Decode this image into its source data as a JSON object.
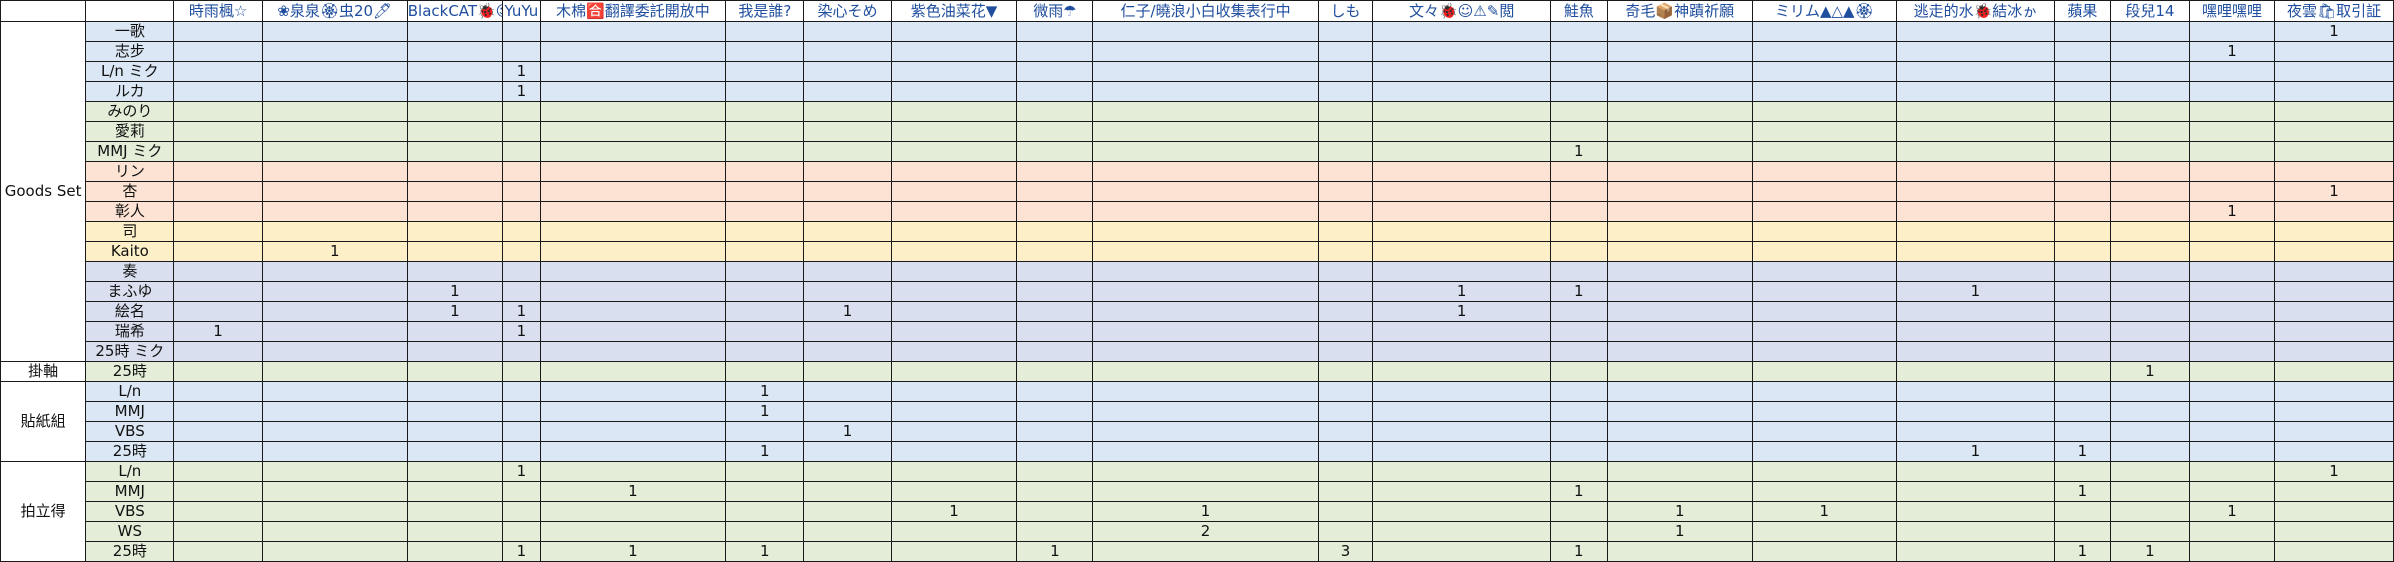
{
  "row_colors": {
    "blue": "#dbe7f4",
    "green": "#e3edd8",
    "orange": "#fce3d4",
    "yellow": "#fdefc8",
    "lavender": "#dadfef"
  },
  "header_color": "#1f4e9e",
  "columns": [
    "時雨楓☆",
    "❀泉泉🏵虫20🖊",
    "BlackCAT🐞☺",
    "YuYu",
    "木棉🈴翻譯委託開放中",
    "我是誰?",
    "染心そめ",
    "紫色油菜花▼",
    "微雨☂",
    "仁子/曉浪小白收集表行中",
    "しも",
    "文々🐞☺⚠✎閲",
    "鮭魚",
    "奇毛📦神蹟祈願",
    "ミリム▲△▲🏵",
    "逃走的水🐞結冰ゕ",
    "蘋果",
    "段兒14",
    "嘿哩嘿哩",
    "夜雲🛍取引証"
  ],
  "groups": [
    {
      "label": "Goods Set",
      "rows": [
        {
          "label": "一歌",
          "color": "blue",
          "cells": [
            "",
            "",
            "",
            "",
            "",
            "",
            "",
            "",
            "",
            "",
            "",
            "",
            "",
            "",
            "",
            "",
            "",
            "",
            "",
            "1"
          ]
        },
        {
          "label": "志步",
          "color": "blue",
          "cells": [
            "",
            "",
            "",
            "",
            "",
            "",
            "",
            "",
            "",
            "",
            "",
            "",
            "",
            "",
            "",
            "",
            "",
            "",
            "1",
            ""
          ]
        },
        {
          "label": "L/n ミク",
          "color": "blue",
          "cells": [
            "",
            "",
            "",
            "1",
            "",
            "",
            "",
            "",
            "",
            "",
            "",
            "",
            "",
            "",
            "",
            "",
            "",
            "",
            "",
            ""
          ]
        },
        {
          "label": "ルカ",
          "color": "blue",
          "cells": [
            "",
            "",
            "",
            "1",
            "",
            "",
            "",
            "",
            "",
            "",
            "",
            "",
            "",
            "",
            "",
            "",
            "",
            "",
            "",
            ""
          ]
        },
        {
          "label": "みのり",
          "color": "green",
          "cells": [
            "",
            "",
            "",
            "",
            "",
            "",
            "",
            "",
            "",
            "",
            "",
            "",
            "",
            "",
            "",
            "",
            "",
            "",
            "",
            ""
          ]
        },
        {
          "label": "愛莉",
          "color": "green",
          "cells": [
            "",
            "",
            "",
            "",
            "",
            "",
            "",
            "",
            "",
            "",
            "",
            "",
            "",
            "",
            "",
            "",
            "",
            "",
            "",
            ""
          ]
        },
        {
          "label": "MMJ ミク",
          "color": "green",
          "cells": [
            "",
            "",
            "",
            "",
            "",
            "",
            "",
            "",
            "",
            "",
            "",
            "",
            "1",
            "",
            "",
            "",
            "",
            "",
            "",
            ""
          ]
        },
        {
          "label": "リン",
          "color": "orange",
          "cells": [
            "",
            "",
            "",
            "",
            "",
            "",
            "",
            "",
            "",
            "",
            "",
            "",
            "",
            "",
            "",
            "",
            "",
            "",
            "",
            ""
          ]
        },
        {
          "label": "杏",
          "color": "orange",
          "cells": [
            "",
            "",
            "",
            "",
            "",
            "",
            "",
            "",
            "",
            "",
            "",
            "",
            "",
            "",
            "",
            "",
            "",
            "",
            "",
            "1"
          ]
        },
        {
          "label": "彰人",
          "color": "orange",
          "cells": [
            "",
            "",
            "",
            "",
            "",
            "",
            "",
            "",
            "",
            "",
            "",
            "",
            "",
            "",
            "",
            "",
            "",
            "",
            "1",
            ""
          ]
        },
        {
          "label": "司",
          "color": "yellow",
          "cells": [
            "",
            "",
            "",
            "",
            "",
            "",
            "",
            "",
            "",
            "",
            "",
            "",
            "",
            "",
            "",
            "",
            "",
            "",
            "",
            ""
          ]
        },
        {
          "label": "Kaito",
          "color": "yellow",
          "cells": [
            "",
            "1",
            "",
            "",
            "",
            "",
            "",
            "",
            "",
            "",
            "",
            "",
            "",
            "",
            "",
            "",
            "",
            "",
            "",
            ""
          ]
        },
        {
          "label": "奏",
          "color": "lavender",
          "cells": [
            "",
            "",
            "",
            "",
            "",
            "",
            "",
            "",
            "",
            "",
            "",
            "",
            "",
            "",
            "",
            "",
            "",
            "",
            "",
            ""
          ]
        },
        {
          "label": "まふゆ",
          "color": "lavender",
          "cells": [
            "",
            "",
            "1",
            "",
            "",
            "",
            "",
            "",
            "",
            "",
            "",
            "1",
            "1",
            "",
            "",
            "1",
            "",
            "",
            "",
            ""
          ]
        },
        {
          "label": "絵名",
          "color": "lavender",
          "cells": [
            "",
            "",
            "1",
            "1",
            "",
            "",
            "1",
            "",
            "",
            "",
            "",
            "1",
            "",
            "",
            "",
            "",
            "",
            "",
            "",
            ""
          ]
        },
        {
          "label": "瑞希",
          "color": "lavender",
          "cells": [
            "1",
            "",
            "",
            "1",
            "",
            "",
            "",
            "",
            "",
            "",
            "",
            "",
            "",
            "",
            "",
            "",
            "",
            "",
            "",
            ""
          ]
        },
        {
          "label": "25時 ミク",
          "color": "lavender",
          "cells": [
            "",
            "",
            "",
            "",
            "",
            "",
            "",
            "",
            "",
            "",
            "",
            "",
            "",
            "",
            "",
            "",
            "",
            "",
            "",
            ""
          ]
        }
      ]
    },
    {
      "label": "掛軸",
      "rows": [
        {
          "label": "25時",
          "color": "green",
          "cells": [
            "",
            "",
            "",
            "",
            "",
            "",
            "",
            "",
            "",
            "",
            "",
            "",
            "",
            "",
            "",
            "",
            "",
            "1",
            "",
            ""
          ]
        }
      ]
    },
    {
      "label": "貼紙組",
      "rows": [
        {
          "label": "L/n",
          "color": "blue",
          "cells": [
            "",
            "",
            "",
            "",
            "",
            "1",
            "",
            "",
            "",
            "",
            "",
            "",
            "",
            "",
            "",
            "",
            "",
            "",
            "",
            ""
          ]
        },
        {
          "label": "MMJ",
          "color": "blue",
          "cells": [
            "",
            "",
            "",
            "",
            "",
            "1",
            "",
            "",
            "",
            "",
            "",
            "",
            "",
            "",
            "",
            "",
            "",
            "",
            "",
            ""
          ]
        },
        {
          "label": "VBS",
          "color": "blue",
          "cells": [
            "",
            "",
            "",
            "",
            "",
            "",
            "1",
            "",
            "",
            "",
            "",
            "",
            "",
            "",
            "",
            "",
            "",
            "",
            "",
            ""
          ]
        },
        {
          "label": "25時",
          "color": "blue",
          "cells": [
            "",
            "",
            "",
            "",
            "",
            "1",
            "",
            "",
            "",
            "",
            "",
            "",
            "",
            "",
            "",
            "1",
            "1",
            "",
            "",
            ""
          ]
        }
      ]
    },
    {
      "label": "拍立得",
      "rows": [
        {
          "label": "L/n",
          "color": "green",
          "cells": [
            "",
            "",
            "",
            "1",
            "",
            "",
            "",
            "",
            "",
            "",
            "",
            "",
            "",
            "",
            "",
            "",
            "",
            "",
            "",
            "1"
          ]
        },
        {
          "label": "MMJ",
          "color": "green",
          "cells": [
            "",
            "",
            "",
            "",
            "1",
            "",
            "",
            "",
            "",
            "",
            "",
            "",
            "1",
            "",
            "",
            "",
            "1",
            "",
            "",
            ""
          ]
        },
        {
          "label": "VBS",
          "color": "green",
          "cells": [
            "",
            "",
            "",
            "",
            "",
            "",
            "",
            "1",
            "",
            "1",
            "",
            "",
            "",
            "1",
            "1",
            "",
            "",
            "",
            "1",
            ""
          ]
        },
        {
          "label": "WS",
          "color": "green",
          "cells": [
            "",
            "",
            "",
            "",
            "",
            "",
            "",
            "",
            "",
            "2",
            "",
            "",
            "",
            "1",
            "",
            "",
            "",
            "",
            "",
            ""
          ]
        },
        {
          "label": "25時",
          "color": "green",
          "cells": [
            "",
            "",
            "",
            "1",
            "1",
            "1",
            "",
            "",
            "1",
            "",
            "3",
            "",
            "1",
            "",
            "",
            "",
            "1",
            "1",
            "",
            ""
          ]
        }
      ]
    }
  ]
}
